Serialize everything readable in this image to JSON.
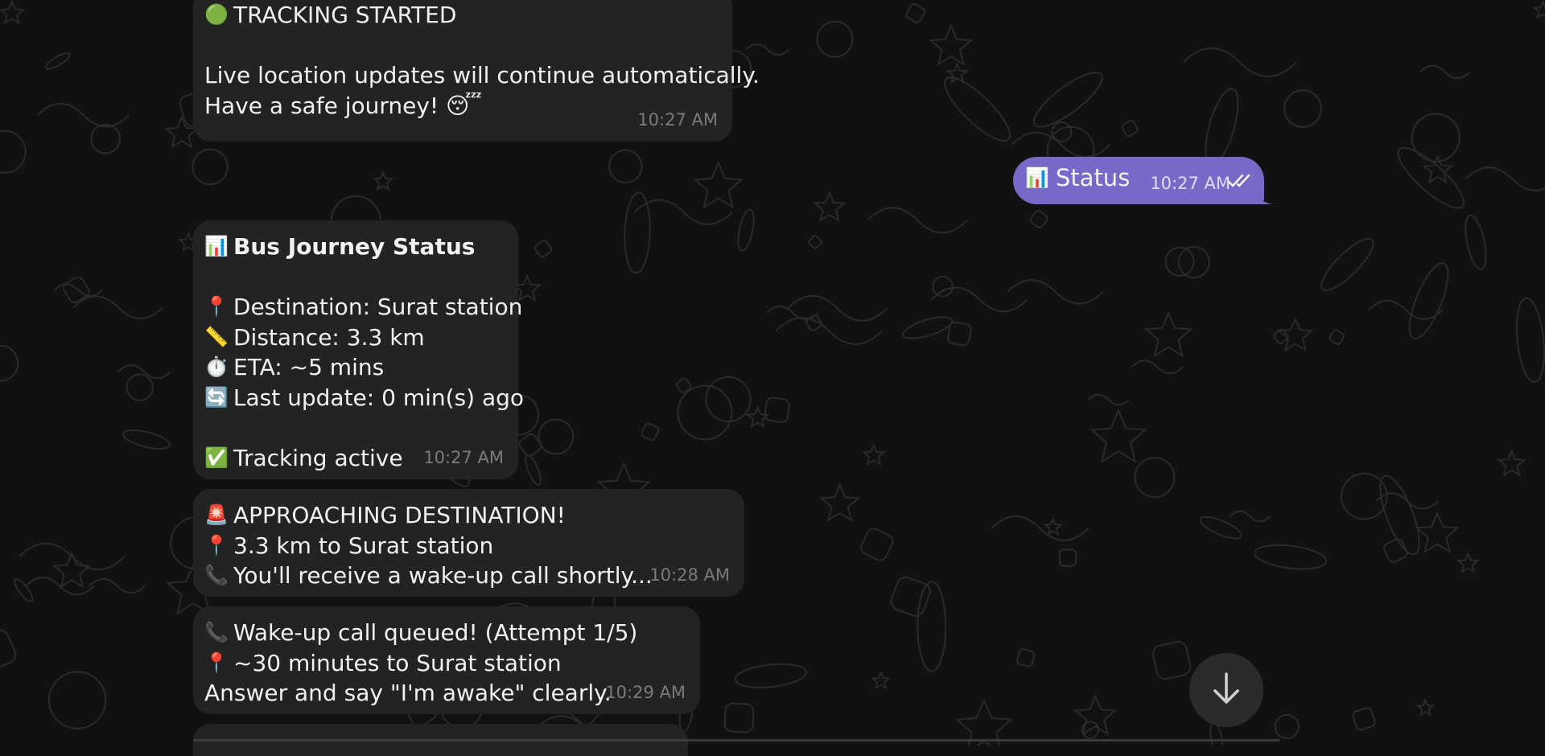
{
  "messages": [
    {
      "lines": [
        {
          "emoji": "🟢",
          "text": "TRACKING STARTED"
        },
        {
          "emoji": "",
          "text": ""
        },
        {
          "emoji": "",
          "text": "Live location updates will continue automatically."
        },
        {
          "emoji": "",
          "text": "Have a safe journey! 😴"
        }
      ],
      "time": "10:27 AM"
    },
    {
      "outgoing": true,
      "emoji": "📊",
      "text": "Status",
      "time": "10:27 AM",
      "read_icon": "double-check-icon"
    },
    {
      "lines": [
        {
          "emoji": "📊",
          "text": "Bus Journey Status",
          "bold": true
        },
        {
          "emoji": "",
          "text": ""
        },
        {
          "emoji": "📍",
          "text": "Destination: Surat station"
        },
        {
          "emoji": "📏",
          "text": "Distance: 3.3 km"
        },
        {
          "emoji": "⏱️",
          "text": "ETA: ~5 mins"
        },
        {
          "emoji": "🔄",
          "text": "Last update: 0 min(s) ago"
        },
        {
          "emoji": "",
          "text": ""
        },
        {
          "emoji": "✅",
          "text": "Tracking active"
        }
      ],
      "time": "10:27 AM"
    },
    {
      "lines": [
        {
          "emoji": "🚨",
          "text": "APPROACHING DESTINATION!"
        },
        {
          "emoji": "📍",
          "text": "3.3 km to Surat station"
        },
        {
          "emoji": "📞",
          "text": "You'll receive a wake-up call shortly..."
        }
      ],
      "time": "10:28 AM"
    },
    {
      "lines": [
        {
          "emoji": "📞",
          "text": "Wake-up call queued! (Attempt 1/5)"
        },
        {
          "emoji": "📍",
          "text": "~30 minutes to Surat station"
        },
        {
          "emoji": "",
          "text": "Answer and say \"I'm awake\" clearly."
        }
      ],
      "time": "10:29 AM"
    }
  ],
  "scroll_button": {
    "icon": "arrow-down-icon"
  },
  "colors": {
    "background": "#111111",
    "incoming_bubble": "#232323",
    "outgoing_bubble": "#7a68c8",
    "timestamp": "#7b7b7b"
  }
}
